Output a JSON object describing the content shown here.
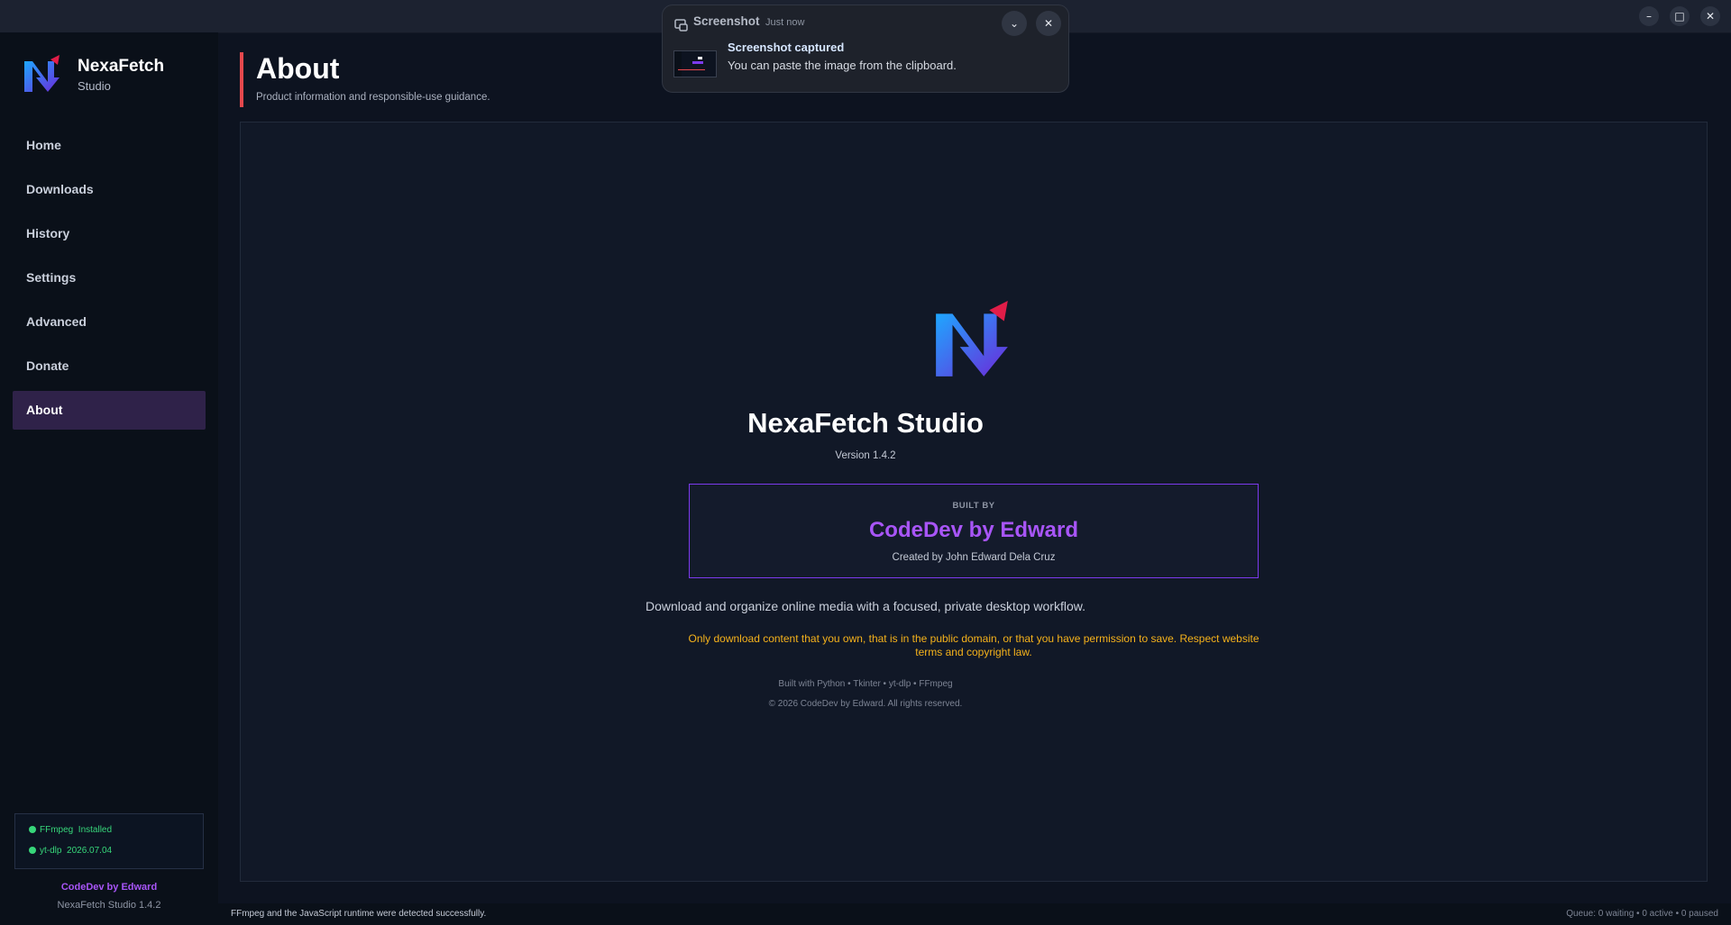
{
  "window": {
    "title": "NexaFetch Studio 1.4.2",
    "controls": [
      "minimize",
      "maximize",
      "close"
    ]
  },
  "sidebar": {
    "brand_name": "NexaFetch",
    "brand_sub": "Studio",
    "items": [
      {
        "label": "Home"
      },
      {
        "label": "Downloads"
      },
      {
        "label": "History"
      },
      {
        "label": "Settings"
      },
      {
        "label": "Advanced"
      },
      {
        "label": "Donate"
      },
      {
        "label": "About",
        "active": true
      }
    ],
    "status": {
      "ffmpeg_name": "FFmpeg",
      "ffmpeg_state": "Installed",
      "ytdlp_name": "yt-dlp",
      "ytdlp_version": "2026.07.04"
    },
    "credit": "CodeDev by Edward",
    "version": "NexaFetch Studio 1.4.2"
  },
  "header": {
    "title": "About",
    "subtitle": "Product information and responsible-use guidance."
  },
  "about": {
    "app_name": "NexaFetch Studio",
    "version": "Version 1.4.2",
    "built_by_label": "BUILT BY",
    "built_by_name": "CodeDev by Edward",
    "creator": "Created by John Edward Dela Cruz",
    "tagline": "Download and organize online media with a focused, private desktop workflow.",
    "warning": "Only download content that you own, that is in the public domain, or that you have permission to save. Respect website terms and copyright law.",
    "built_with": "Built with Python • Tkinter • yt-dlp • FFmpeg",
    "copyright": "© 2026 CodeDev by Edward. All rights reserved."
  },
  "statusbar": {
    "message": "FFmpeg and the JavaScript runtime were detected successfully.",
    "queue": "Queue: 0 waiting • 0 active • 0 paused"
  },
  "toast": {
    "app": "Screenshot",
    "time": "Just now",
    "heading": "Screenshot captured",
    "body": "You can paste the image from the clipboard."
  },
  "colors": {
    "accent": "#a855f7",
    "header_bar": "#e5484d",
    "warning": "#f5b21b",
    "status_ok": "#37d67a",
    "active_nav": "#2f2249"
  }
}
